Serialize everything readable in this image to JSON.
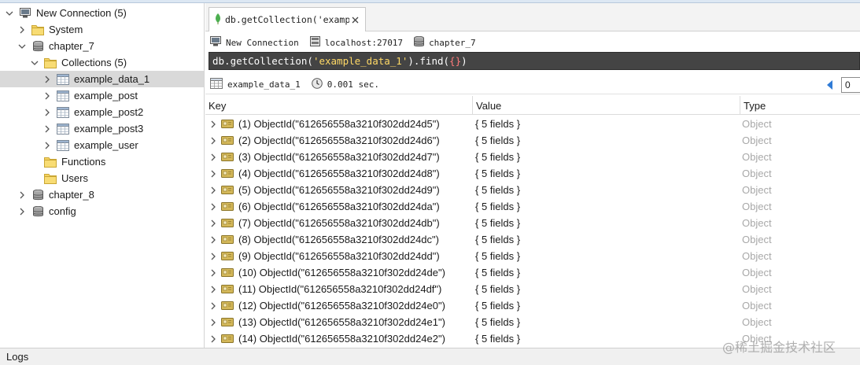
{
  "tree": {
    "items": [
      {
        "label": "New Connection (5)",
        "icon": "computer-icon",
        "twisty": "expanded",
        "indent": 0,
        "name": "tree-item-new-connection",
        "selected": false
      },
      {
        "label": "System",
        "icon": "folder-icon",
        "twisty": "collapsed",
        "indent": 1,
        "name": "tree-item-system",
        "selected": false
      },
      {
        "label": "chapter_7",
        "icon": "database-icon",
        "twisty": "expanded",
        "indent": 1,
        "name": "tree-item-chapter-7",
        "selected": false
      },
      {
        "label": "Collections (5)",
        "icon": "folder-icon",
        "twisty": "expanded",
        "indent": 2,
        "name": "tree-item-collections",
        "selected": false
      },
      {
        "label": "example_data_1",
        "icon": "collection-icon",
        "twisty": "collapsed",
        "indent": 3,
        "name": "tree-item-example-data-1",
        "selected": true
      },
      {
        "label": "example_post",
        "icon": "collection-icon",
        "twisty": "collapsed",
        "indent": 3,
        "name": "tree-item-example-post",
        "selected": false
      },
      {
        "label": "example_post2",
        "icon": "collection-icon",
        "twisty": "collapsed",
        "indent": 3,
        "name": "tree-item-example-post2",
        "selected": false
      },
      {
        "label": "example_post3",
        "icon": "collection-icon",
        "twisty": "collapsed",
        "indent": 3,
        "name": "tree-item-example-post3",
        "selected": false
      },
      {
        "label": "example_user",
        "icon": "collection-icon",
        "twisty": "collapsed",
        "indent": 3,
        "name": "tree-item-example-user",
        "selected": false
      },
      {
        "label": "Functions",
        "icon": "folder-icon",
        "twisty": "none",
        "indent": 2,
        "name": "tree-item-functions",
        "selected": false
      },
      {
        "label": "Users",
        "icon": "folder-icon",
        "twisty": "none",
        "indent": 2,
        "name": "tree-item-users",
        "selected": false
      },
      {
        "label": "chapter_8",
        "icon": "database-icon",
        "twisty": "collapsed",
        "indent": 1,
        "name": "tree-item-chapter-8",
        "selected": false
      },
      {
        "label": "config",
        "icon": "database-icon",
        "twisty": "collapsed",
        "indent": 1,
        "name": "tree-item-config",
        "selected": false
      }
    ]
  },
  "tab": {
    "title": "db.getCollection('example…",
    "icon": "leaf-icon",
    "close_icon": "close-icon"
  },
  "connection": {
    "name": "New Connection",
    "host": "localhost:27017",
    "database": "chapter_7"
  },
  "query": {
    "prefix": "db.getCollection(",
    "arg": "'example_data_1'",
    "middle": ").find(",
    "braces": "{}",
    "suffix": ")"
  },
  "result": {
    "collection": "example_data_1",
    "time": "0.001 sec.",
    "page_value": "0"
  },
  "grid": {
    "columns": {
      "key": "Key",
      "value": "Value",
      "type": "Type"
    },
    "rows": [
      {
        "key": "(1) ObjectId(\"612656558a3210f302dd24d5\")",
        "value": "{ 5 fields }",
        "type": "Object"
      },
      {
        "key": "(2) ObjectId(\"612656558a3210f302dd24d6\")",
        "value": "{ 5 fields }",
        "type": "Object"
      },
      {
        "key": "(3) ObjectId(\"612656558a3210f302dd24d7\")",
        "value": "{ 5 fields }",
        "type": "Object"
      },
      {
        "key": "(4) ObjectId(\"612656558a3210f302dd24d8\")",
        "value": "{ 5 fields }",
        "type": "Object"
      },
      {
        "key": "(5) ObjectId(\"612656558a3210f302dd24d9\")",
        "value": "{ 5 fields }",
        "type": "Object"
      },
      {
        "key": "(6) ObjectId(\"612656558a3210f302dd24da\")",
        "value": "{ 5 fields }",
        "type": "Object"
      },
      {
        "key": "(7) ObjectId(\"612656558a3210f302dd24db\")",
        "value": "{ 5 fields }",
        "type": "Object"
      },
      {
        "key": "(8) ObjectId(\"612656558a3210f302dd24dc\")",
        "value": "{ 5 fields }",
        "type": "Object"
      },
      {
        "key": "(9) ObjectId(\"612656558a3210f302dd24dd\")",
        "value": "{ 5 fields }",
        "type": "Object"
      },
      {
        "key": "(10) ObjectId(\"612656558a3210f302dd24de\")",
        "value": "{ 5 fields }",
        "type": "Object"
      },
      {
        "key": "(11) ObjectId(\"612656558a3210f302dd24df\")",
        "value": "{ 5 fields }",
        "type": "Object"
      },
      {
        "key": "(12) ObjectId(\"612656558a3210f302dd24e0\")",
        "value": "{ 5 fields }",
        "type": "Object"
      },
      {
        "key": "(13) ObjectId(\"612656558a3210f302dd24e1\")",
        "value": "{ 5 fields }",
        "type": "Object"
      },
      {
        "key": "(14) ObjectId(\"612656558a3210f302dd24e2\")",
        "value": "{ 5 fields }",
        "type": "Object"
      }
    ]
  },
  "logs": {
    "label": "Logs"
  },
  "watermark": "@稀土掘金技术社区",
  "colors": {
    "query_bg": "#444444",
    "query_text": "#ffffff",
    "query_string": "#ffd966",
    "query_braces": "#ff7b7b",
    "selected_row": "#d9d9d9",
    "type_text": "#a8a8a8",
    "folder": "#f5d262",
    "leaf": "#4caf50"
  }
}
